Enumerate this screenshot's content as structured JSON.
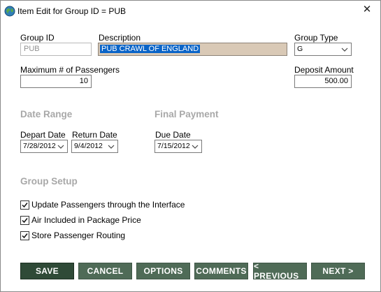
{
  "window": {
    "title": "Item Edit for Group ID = PUB",
    "close_glyph": "✕"
  },
  "form": {
    "group_id_label": "Group ID",
    "group_id_value": "PUB",
    "description_label": "Description",
    "description_value": "PUB CRAWL OF ENGLAND",
    "group_type_label": "Group Type",
    "group_type_value": "G",
    "max_pax_label": "Maximum # of Passengers",
    "max_pax_value": "10",
    "deposit_label": "Deposit Amount",
    "deposit_value": "500.00"
  },
  "date_range": {
    "heading": "Date Range",
    "depart_label": "Depart Date",
    "depart_value": "7/28/2012",
    "return_label": "Return Date",
    "return_value": "9/4/2012"
  },
  "final_payment": {
    "heading": "Final Payment",
    "due_label": "Due Date",
    "due_value": "7/15/2012"
  },
  "group_setup": {
    "heading": "Group Setup",
    "options": [
      {
        "label": "Update Passengers through the Interface",
        "checked": true
      },
      {
        "label": "Air Included in Package Price",
        "checked": true
      },
      {
        "label": "Store Passenger Routing",
        "checked": true
      }
    ]
  },
  "buttons": {
    "save": "SAVE",
    "cancel": "CANCEL",
    "options": "OPTIONS",
    "comments": "COMMENTS",
    "previous": "< PREVIOUS",
    "next": "NEXT >"
  },
  "colors": {
    "button_bg": "#4f6b57",
    "button_primary_bg": "#2f4a37",
    "selection": "#0a64c8",
    "section_heading": "#a8a8a8",
    "description_bg": "#d9c9b6"
  },
  "icons": {
    "app": "globe-icon",
    "close": "close-icon",
    "dropdown": "chevron-down-icon",
    "checkbox": "checkmark-icon"
  }
}
